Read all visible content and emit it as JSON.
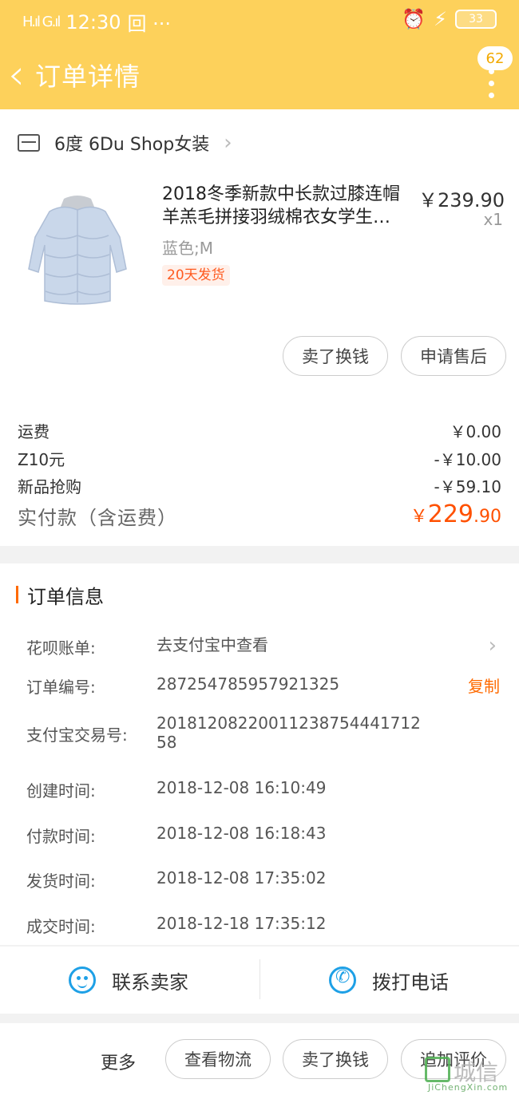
{
  "status_bar": {
    "signal": "H.ıl G.ıl",
    "time": "12:30",
    "extra": "回 ···",
    "alarm_icon": "alarm-icon",
    "battery": "33"
  },
  "nav": {
    "title": "订单详情",
    "badge": "62"
  },
  "shop": {
    "name": "6度 6Du Shop女装"
  },
  "product": {
    "title": "2018冬季新款中长款过膝连帽羊羔毛拼接羽绒棉衣女学生…",
    "price": "￥239.90",
    "qty": "x1",
    "spec": "蓝色;M",
    "tag": "20天发货"
  },
  "product_buttons": {
    "sell": "卖了换钱",
    "after_sale": "申请售后"
  },
  "fees": [
    {
      "label": "运费",
      "value": "￥0.00"
    },
    {
      "label": "Z10元",
      "value": "-￥10.00"
    },
    {
      "label": "新品抢购",
      "value": "-￥59.10"
    }
  ],
  "paid": {
    "label": "实付款（含运费）",
    "currency": "￥",
    "integer": "229",
    "decimal": ".90"
  },
  "order_info": {
    "title": "订单信息",
    "rows": [
      {
        "label": "花呗账单:",
        "value": "去支付宝中查看"
      },
      {
        "label": "订单编号:",
        "value": "287254785957921325"
      },
      {
        "label": "支付宝交易号:",
        "value": "2018120822001123875444171258"
      },
      {
        "label": "创建时间:",
        "value": "2018-12-08 16:10:49"
      },
      {
        "label": "付款时间:",
        "value": "2018-12-08 16:18:43"
      },
      {
        "label": "发货时间:",
        "value": "2018-12-08 17:35:02"
      },
      {
        "label": "成交时间:",
        "value": "2018-12-18 17:35:12"
      }
    ],
    "copy": "复制"
  },
  "contact": {
    "chat": "联系卖家",
    "phone": "拨打电话"
  },
  "bottom": {
    "more": "更多",
    "logistics": "查看物流",
    "sell": "卖了换钱",
    "review": "追加评价"
  },
  "watermark": {
    "text": "城信",
    "sub": "JiChengXin.com"
  }
}
